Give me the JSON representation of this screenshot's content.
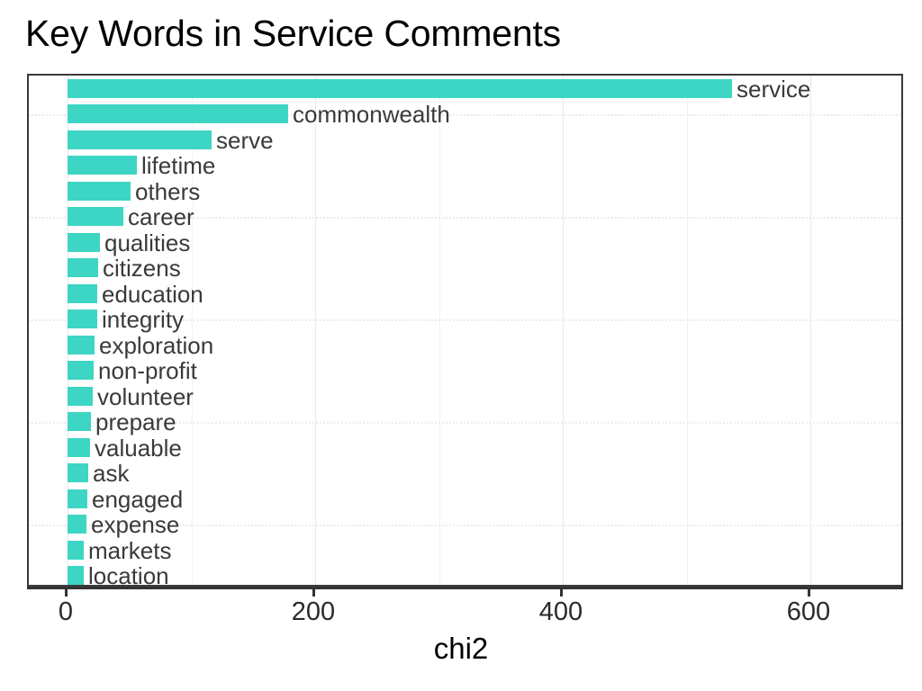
{
  "chart_data": {
    "type": "bar",
    "orientation": "horizontal",
    "title": "Key Words in Service Comments",
    "xlabel": "chi2",
    "ylabel": "",
    "xlim": [
      0,
      685
    ],
    "xticks": [
      0,
      200,
      400,
      600
    ],
    "xtick_labels": [
      "0",
      "200",
      "400",
      "600"
    ],
    "grid": "vertical major and minor gridlines, light dotted horizontal guides",
    "legend": "none",
    "bar_color": "#3dd5c4",
    "categories": [
      "service",
      "commonwealth",
      "serve",
      "lifetime",
      "others",
      "career",
      "qualities",
      "citizens",
      "education",
      "integrity",
      "exploration",
      "non-profit",
      "volunteer",
      "prepare",
      "valuable",
      "ask",
      "engaged",
      "expense",
      "markets",
      "location"
    ],
    "values": [
      537,
      178,
      116,
      56,
      51,
      45,
      26,
      25,
      24,
      24,
      22,
      21,
      20,
      19,
      18,
      17,
      16,
      15,
      13,
      13
    ],
    "labels_inside_panel": true
  },
  "axis": {
    "x_title": "chi2"
  }
}
